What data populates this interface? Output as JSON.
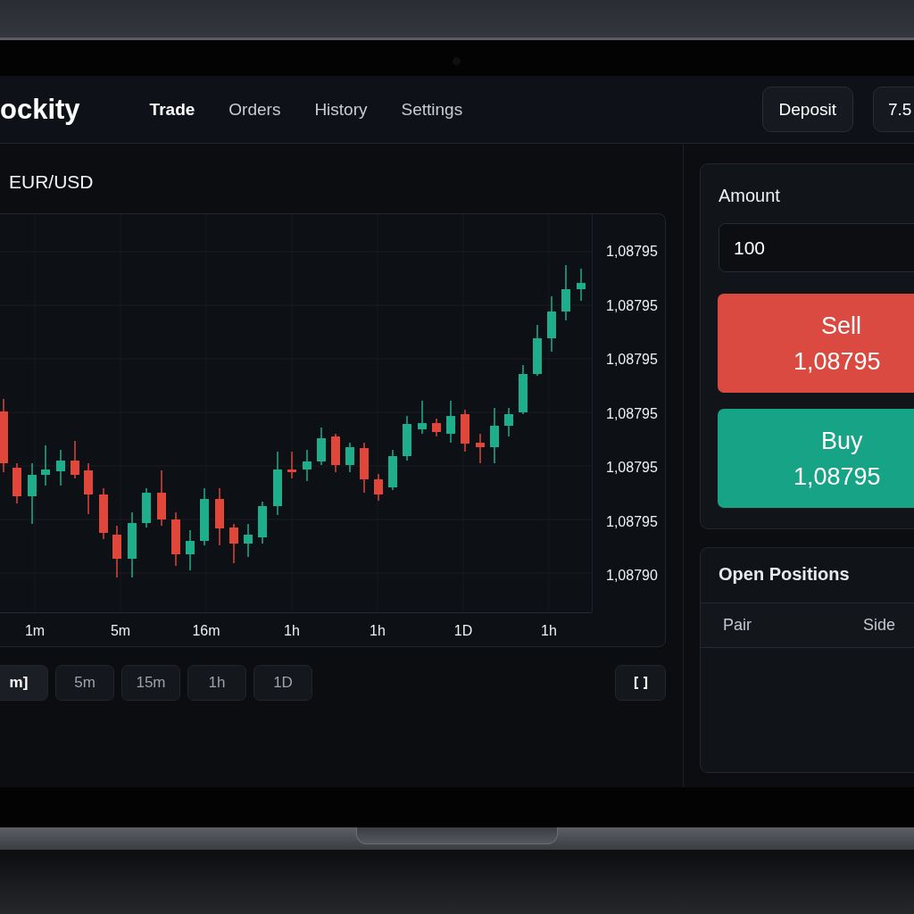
{
  "app": {
    "logo": "ockity"
  },
  "nav": [
    {
      "label": "Trade",
      "selected": true
    },
    {
      "label": "Orders",
      "selected": false
    },
    {
      "label": "History",
      "selected": false
    },
    {
      "label": "Settings",
      "selected": false
    }
  ],
  "header_actions": {
    "deposit": "Deposit",
    "balance": "7.5"
  },
  "chart": {
    "pair": "EUR/USD",
    "price_labels": [
      "1,08795",
      "1,08795",
      "1,08795",
      "1,08795",
      "1,08795",
      "1,08795",
      "1,08790"
    ],
    "time_labels": [
      "1m",
      "5m",
      "16m",
      "1h",
      "1h",
      "1D",
      "1h"
    ]
  },
  "timeframes": [
    {
      "label": "m]",
      "selected": true
    },
    {
      "label": "5m",
      "selected": false
    },
    {
      "label": "15m",
      "selected": false
    },
    {
      "label": "1h",
      "selected": false
    },
    {
      "label": "1D",
      "selected": false
    }
  ],
  "trade_panel": {
    "amount_label": "Amount",
    "amount_value": "100",
    "sell": {
      "label": "Sell",
      "price": "1,08795"
    },
    "buy": {
      "label": "Buy",
      "price": "1,08795"
    }
  },
  "positions": {
    "title": "Open Positions",
    "columns": [
      "Pair",
      "Side"
    ]
  }
}
